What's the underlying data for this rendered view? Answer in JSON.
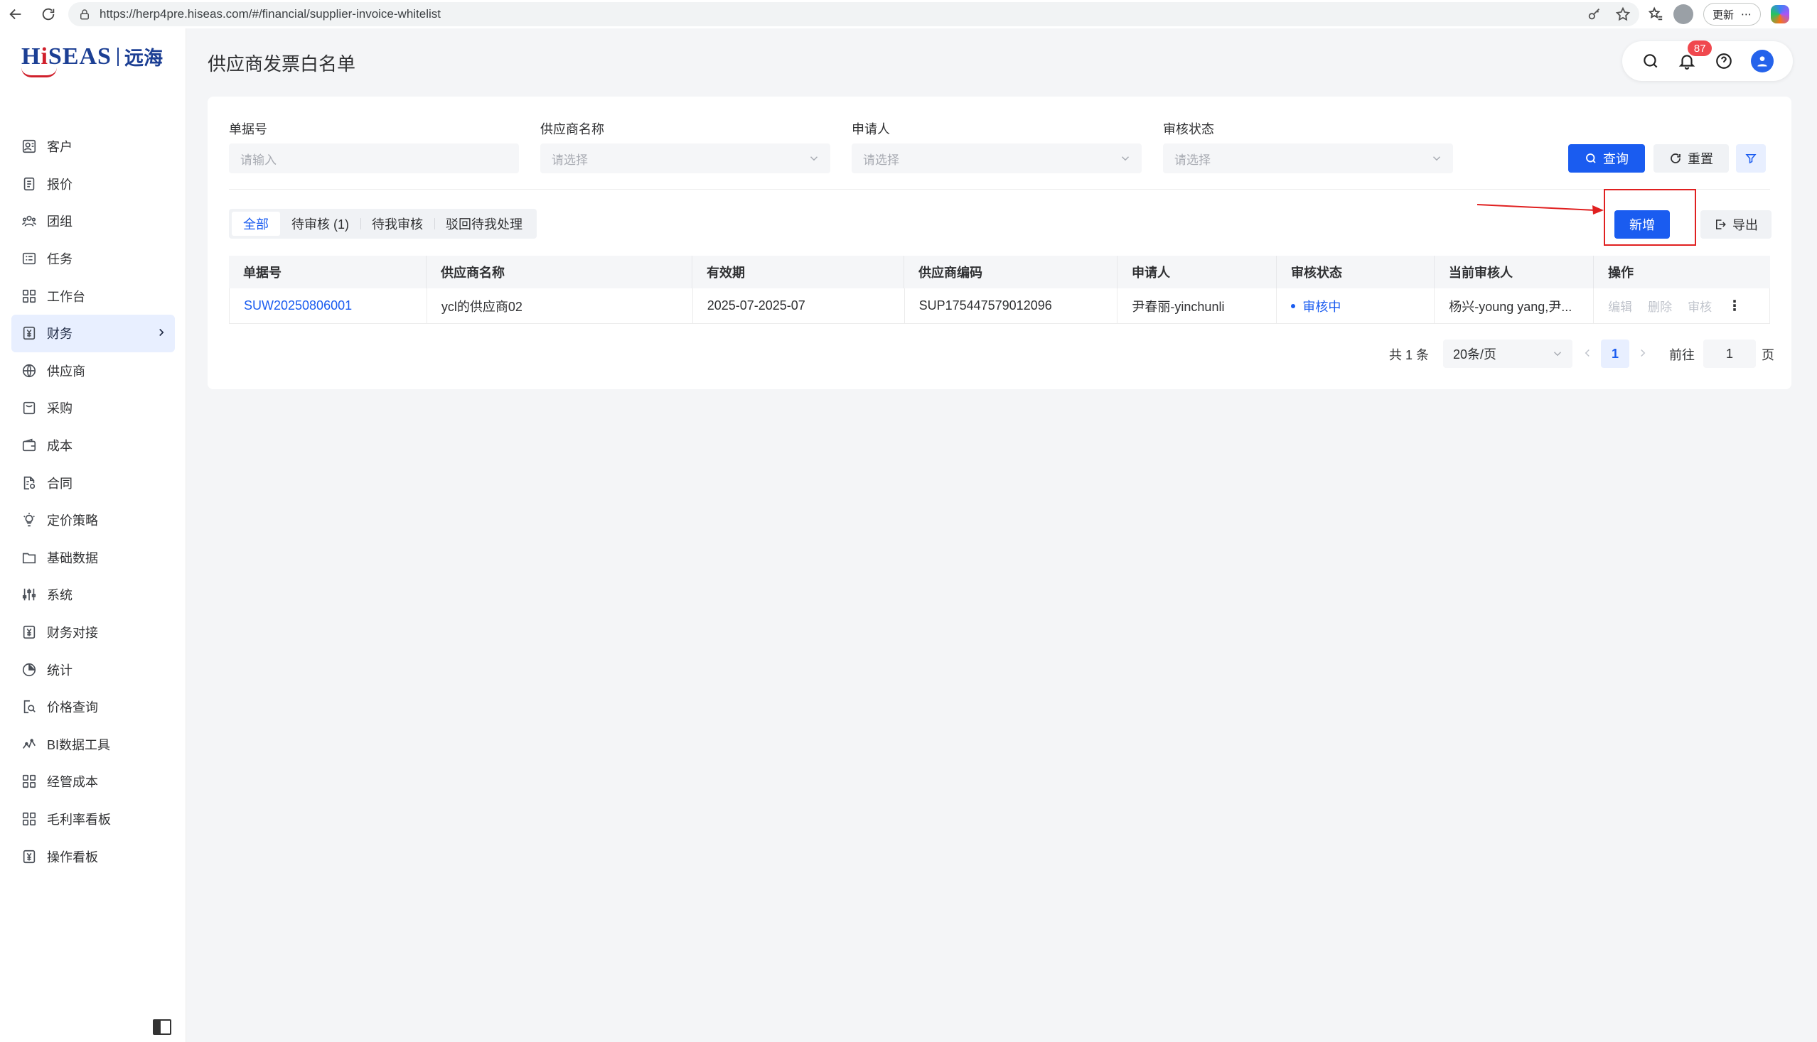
{
  "browser": {
    "url": "https://herp4pre.hiseas.com/#/financial/supplier-invoice-whitelist",
    "update_label": "更新"
  },
  "logo": {
    "brand_pre": "H",
    "brand_i": "i",
    "brand_post": "SEAS",
    "cn": "远海"
  },
  "sidebar": {
    "items": [
      {
        "label": "客户",
        "icon": "users-icon"
      },
      {
        "label": "报价",
        "icon": "document-icon"
      },
      {
        "label": "团组",
        "icon": "group-icon"
      },
      {
        "label": "任务",
        "icon": "task-icon"
      },
      {
        "label": "工作台",
        "icon": "grid-icon"
      },
      {
        "label": "财务",
        "icon": "yen-icon",
        "active": true
      },
      {
        "label": "供应商",
        "icon": "globe-icon"
      },
      {
        "label": "采购",
        "icon": "bag-icon"
      },
      {
        "label": "成本",
        "icon": "wallet-icon"
      },
      {
        "label": "合同",
        "icon": "contract-icon"
      },
      {
        "label": "定价策略",
        "icon": "bulb-icon"
      },
      {
        "label": "基础数据",
        "icon": "folder-icon"
      },
      {
        "label": "系统",
        "icon": "sliders-icon"
      },
      {
        "label": "财务对接",
        "icon": "yen-icon"
      },
      {
        "label": "统计",
        "icon": "pie-icon"
      },
      {
        "label": "价格查询",
        "icon": "search-doc-icon"
      },
      {
        "label": "BI数据工具",
        "icon": "chart-line-icon"
      },
      {
        "label": "经管成本",
        "icon": "grid-icon"
      },
      {
        "label": "毛利率看板",
        "icon": "grid-icon"
      },
      {
        "label": "操作看板",
        "icon": "yen-icon"
      }
    ]
  },
  "header": {
    "title": "供应商发票白名单",
    "notification_count": "87"
  },
  "filters": {
    "doc_no": {
      "label": "单据号",
      "placeholder": "请输入"
    },
    "supplier": {
      "label": "供应商名称",
      "placeholder": "请选择"
    },
    "applicant": {
      "label": "申请人",
      "placeholder": "请选择"
    },
    "status": {
      "label": "审核状态",
      "placeholder": "请选择"
    },
    "query_label": "查询",
    "reset_label": "重置"
  },
  "tabs": [
    {
      "label": "全部",
      "active": true
    },
    {
      "label": "待审核 (1)"
    },
    {
      "label": "待我审核"
    },
    {
      "label": "驳回待我处理"
    }
  ],
  "actions": {
    "add_label": "新增",
    "export_label": "导出"
  },
  "table": {
    "columns": [
      "单据号",
      "供应商名称",
      "有效期",
      "供应商编码",
      "申请人",
      "审核状态",
      "当前审核人",
      "操作"
    ],
    "rows": [
      {
        "doc_no": "SUW20250806001",
        "supplier": "ycl的供应商02",
        "validity": "2025-07-2025-07",
        "supplier_code": "SUP175447579012096",
        "applicant": "尹春丽-yinchunli",
        "status": "审核中",
        "reviewer": "杨兴-young yang,尹...",
        "ops": [
          "编辑",
          "删除",
          "审核"
        ]
      }
    ]
  },
  "pagination": {
    "total": "共 1 条",
    "page_size": "20条/页",
    "current": "1",
    "goto_label": "前往",
    "goto_value": "1",
    "page_unit": "页"
  },
  "colors": {
    "primary": "#1a5cf0",
    "highlight": "#e02020",
    "badge": "#f0484e"
  }
}
